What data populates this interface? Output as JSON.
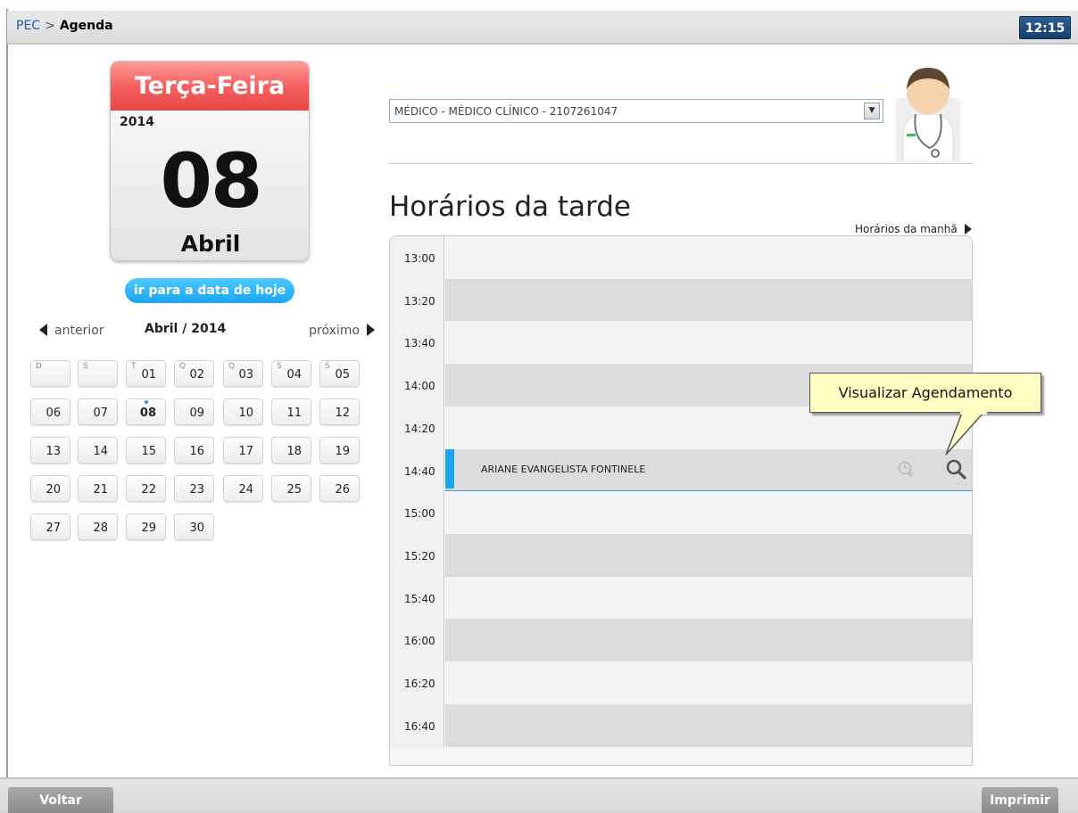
{
  "header": {
    "breadcrumb_root": "PEC",
    "breadcrumb_separator": ">",
    "breadcrumb_current": "Agenda",
    "clock": "12:15"
  },
  "date_card": {
    "weekday": "Terça-Feira",
    "year": "2014",
    "day": "08",
    "month": "Abril"
  },
  "today_button": "ir para a data de hoje",
  "month_nav": {
    "prev": "anterior",
    "title": "Abril / 2014",
    "next": "próximo"
  },
  "calendar": {
    "weekday_letters": [
      "D",
      "S",
      "T",
      "Q",
      "Q",
      "S",
      "S"
    ],
    "first_row": [
      "",
      "",
      "01",
      "02",
      "03",
      "04",
      "05"
    ],
    "rows": [
      [
        "06",
        "07",
        "08",
        "09",
        "10",
        "11",
        "12"
      ],
      [
        "13",
        "14",
        "15",
        "16",
        "17",
        "18",
        "19"
      ],
      [
        "20",
        "21",
        "22",
        "23",
        "24",
        "25",
        "26"
      ],
      [
        "27",
        "28",
        "29",
        "30"
      ]
    ],
    "selected": "08"
  },
  "professional_select": {
    "value": "MÉDICO - MÉDICO CLÍNICO - 2107261047"
  },
  "schedule": {
    "title": "Horários da tarde",
    "morning_link": "Horários da manhã",
    "times": [
      "13:00",
      "13:20",
      "13:40",
      "14:00",
      "14:20",
      "14:40",
      "15:00",
      "15:20",
      "15:40",
      "16:00",
      "16:20",
      "16:40"
    ],
    "appointment": {
      "time": "14:40",
      "patient": "ARIANE EVANGELISTA FONTINELE"
    }
  },
  "tooltip": "Visualizar Agendamento",
  "footer": {
    "back": "Voltar",
    "print": "Imprimir"
  },
  "colors": {
    "accent": "#1aa6ef",
    "header_red": "#f45c5c",
    "clock_bg": "#163e6c"
  }
}
